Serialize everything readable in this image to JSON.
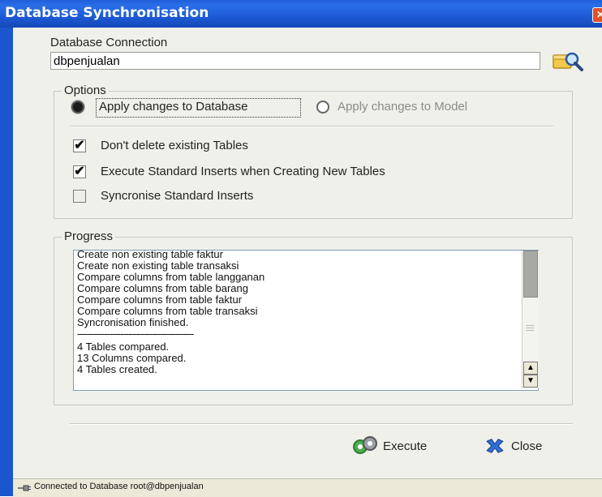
{
  "window": {
    "title": "Database Synchronisation",
    "close_glyph": "✕"
  },
  "connection": {
    "label": "Database Connection",
    "value": "dbpenjualan",
    "browse_icon": "database-search-icon"
  },
  "options": {
    "legend": "Options",
    "radio_apply_db": "Apply changes to Database",
    "radio_apply_db_selected": true,
    "radio_apply_model": "Apply changes to Model",
    "check_dont_delete": "Don't delete existing Tables",
    "check_dont_delete_checked": true,
    "check_execute_inserts": "Execute Standard Inserts when Creating New Tables",
    "check_execute_inserts_checked": true,
    "check_sync_inserts": "Syncronise Standard Inserts",
    "check_sync_inserts_checked": false,
    "check_mark": "✔"
  },
  "progress": {
    "legend": "Progress",
    "lines": [
      "Create non existing table faktur",
      "Create non existing table transaksi",
      "Compare columns from table langganan",
      "Compare columns from table barang",
      "Compare columns from table faktur",
      "Compare columns from table transaksi",
      "Syncronisation finished.",
      "-------------------------------------------",
      "4 Tables compared.",
      "13 Columns compared.",
      "4 Tables created."
    ],
    "scroll_up_glyph": "▲",
    "scroll_down_glyph": "▼"
  },
  "buttons": {
    "execute": "Execute",
    "close": "Close"
  },
  "status": {
    "text": "Connected to Database root@dbpenjualan"
  },
  "colors": {
    "titlebar": "#1d5ad6",
    "client_bg": "#f0f0ea",
    "close_red": "#e0502a"
  }
}
